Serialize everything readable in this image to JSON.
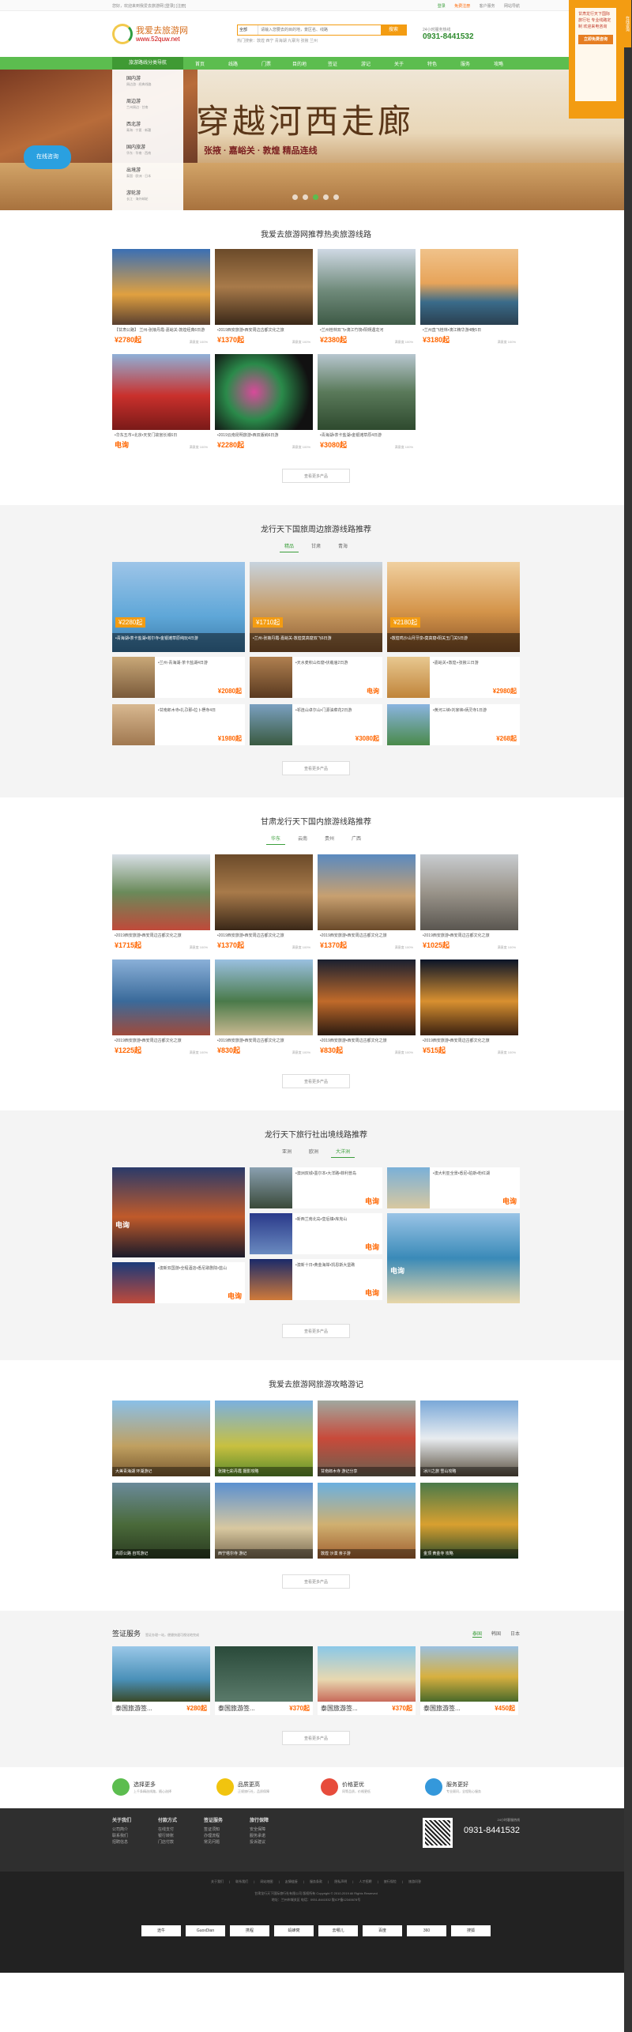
{
  "topbar": {
    "welcome": "您好，欢迎来到我爱去旅游网 [登录] [注册]",
    "links": [
      "登录",
      "免费注册",
      "客户服务",
      "网站导航"
    ]
  },
  "header": {
    "logo_cn": "我爱去旅游网",
    "logo_url": "www.52quw.net",
    "search_select": "全部",
    "search_placeholder": "请输入您要去的目的地，景区名、线路",
    "search_button": "搜索",
    "hot": "热门搜索：敦煌 西宁 青海湖 九寨沟 张掖 兰州",
    "hotline_label": "24小时服务热线",
    "hotline": "0931-8441532"
  },
  "nav": {
    "category": "旅游路线分类导航",
    "items": [
      "首页",
      "线路",
      "门票",
      "目的地",
      "签证",
      "游记",
      "关于",
      "特色",
      "服务",
      "攻略"
    ]
  },
  "banner": {
    "title": "穿越河西走廊",
    "sub": "张掖 · 嘉峪关 · 敦煌 精品连线"
  },
  "catmenu": [
    {
      "t": "国内游",
      "s": "周边游 · 经典线路"
    },
    {
      "t": "周边游",
      "s": "兰州周边 · 甘南"
    },
    {
      "t": "西北游",
      "s": "青海 · 宁夏 · 新疆"
    },
    {
      "t": "国内旅游",
      "s": "华东 · 华南 · 西南"
    },
    {
      "t": "出境游",
      "s": "泰国 · 欧洲 · 日本"
    },
    {
      "t": "游轮游",
      "s": "长江 · 海外邮轮"
    }
  ],
  "online": "在线咨询",
  "sec1": {
    "title": "我爱去旅游网推荐热卖旅游线路",
    "more": "查看更多产品",
    "items": [
      {
        "t": "【甘肃公路】 兰州-张掖丹霞-嘉峪关-敦煌经典6日游",
        "p": "¥2780起",
        "s": "满意度 100%"
      },
      {
        "t": "•2019西安旅游•西安周边古都文化之旅",
        "p": "¥1370起",
        "s": "满意度 100%"
      },
      {
        "t": "•兰州桂林双飞•漓江竹筏•阳朔遇龙河",
        "p": "¥2380起",
        "s": "满意度 100%"
      },
      {
        "t": "•兰州直飞桂林•漓江精华游4晚5日",
        "p": "¥3180起",
        "s": "满意度 100%"
      },
      {
        "t": "•华东五市+北京•天安门故宫长城6日",
        "p": "电询",
        "s": "满意度 100%"
      },
      {
        "t": "•2019云南昆明旅游•西双版纳6日游",
        "p": "¥2280起",
        "s": "满意度 100%"
      },
      {
        "t": "•青海湖•茶卡盐湖•金银滩草原4日游",
        "p": "¥3080起",
        "s": "满意度 100%"
      },
      {
        "t": "",
        "p": "",
        "s": ""
      }
    ]
  },
  "sec2": {
    "title": "龙行天下国旅周边旅游线路推荐",
    "tabs": [
      "精品",
      "甘肃",
      "青海"
    ],
    "more": "查看更多产品",
    "feat": [
      {
        "p": "¥2280起",
        "c": "•青海湖•茶卡盐湖•塔尔寺•金银滩草原纯玩4日游"
      },
      {
        "p": "¥1710起",
        "c": "•兰州-张掖丹霞-嘉峪关-敦煌莫高窟双飞6日游"
      },
      {
        "p": "¥2180起",
        "c": "•敦煌鸣沙山月牙泉•莫高窟•阳关玉门关5日游"
      }
    ],
    "mini": [
      {
        "t": "•兰州-青海湖-茶卡盐湖4日游",
        "p": "¥2080起"
      },
      {
        "t": "•天水麦积山石窟•伏羲庙2日游",
        "p": "电询"
      },
      {
        "t": "•嘉峪关+敦煌+张掖三日游",
        "p": "¥2980起"
      },
      {
        "t": "•甘南郎木寺•扎尕那•拉卜楞寺4日",
        "p": "¥1980起"
      },
      {
        "t": "•祁连山卓尔山•门源油菜花2日游",
        "p": "¥3080起"
      },
      {
        "t": "•黄河三峡•刘家峡•炳灵寺1日游",
        "p": "¥268起"
      }
    ]
  },
  "sec3": {
    "title": "甘肃龙行天下国内旅游线路推荐",
    "tabs": [
      "华东",
      "云南",
      "贵州",
      "广西"
    ],
    "more": "查看更多产品",
    "items": [
      {
        "t": "•2019西安旅游•西安周边古都文化之旅",
        "p": "¥1715起",
        "s": "满意度 100%"
      },
      {
        "t": "•2019西安旅游•西安周边古都文化之旅",
        "p": "¥1370起",
        "s": "满意度 100%"
      },
      {
        "t": "•2019西安旅游•西安周边古都文化之旅",
        "p": "¥1370起",
        "s": "满意度 100%"
      },
      {
        "t": "•2019西安旅游•西安周边古都文化之旅",
        "p": "¥1025起",
        "s": "满意度 100%"
      },
      {
        "t": "•2019西安旅游•西安周边古都文化之旅",
        "p": "¥1225起",
        "s": "满意度 100%"
      },
      {
        "t": "•2019西安旅游•西安周边古都文化之旅",
        "p": "¥830起",
        "s": "满意度 100%"
      },
      {
        "t": "•2019西安旅游•西安周边古都文化之旅",
        "p": "¥830起",
        "s": "满意度 100%"
      },
      {
        "t": "•2019西安旅游•西安周边古都文化之旅",
        "p": "¥515起",
        "s": "满意度 100%"
      }
    ]
  },
  "sec4": {
    "title": "龙行天下旅行社出境线路推荐",
    "tabs": [
      "亚洲",
      "欧洲",
      "大洋洲"
    ],
    "more": "查看更多产品",
    "big1": "电询",
    "big2": "电询",
    "rows": [
      {
        "t": "•澳新双国游•全程酒店•悉尼歌剧院•蓝山",
        "p": "电询"
      },
      {
        "t": "•澳洲双城•墨尔本•大洋路•菲利普岛",
        "p": "电询"
      },
      {
        "t": "•新西兰南北岛•皇后镇•库克山",
        "p": "电询"
      },
      {
        "t": "•澳新十日•黄金海岸•凯恩斯大堡礁",
        "p": "电询"
      },
      {
        "t": "•澳大利亚全景•悉尼•珀斯•粉红湖",
        "p": "电询"
      }
    ]
  },
  "sec5": {
    "title": "我爱去旅游网旅游攻略游记",
    "more": "查看更多产品",
    "items": [
      "大美青海湖 环湖游记",
      "张掖七彩丹霞 摄影攻略",
      "甘南郎木寺 游记分享",
      "冰川之旅 雪山攻略",
      "高原公路 自驾游记",
      "西宁塔尔寺 游记",
      "敦煌 沙漠 亲子游",
      "金顶 黄金寺 攻略"
    ]
  },
  "visa": {
    "title": "签证服务",
    "note": "签证办理一站，便捷快速可视化地完成",
    "tabs": [
      "泰国",
      "韩国",
      "日本"
    ],
    "more": "查看更多产品",
    "items": [
      {
        "n": "泰国旅游签...",
        "p": "¥280起"
      },
      {
        "n": "泰国旅游签...",
        "p": "¥370起"
      },
      {
        "n": "泰国旅游签...",
        "p": "¥370起"
      },
      {
        "n": "泰国旅游签...",
        "p": "¥450起"
      }
    ]
  },
  "svc": [
    {
      "t": "选择更多",
      "s": "上千条精选线路，随心选择"
    },
    {
      "t": "品质更高",
      "s": "正规旅行社，品质保障"
    },
    {
      "t": "价格更优",
      "s": "同等品质，价格更低"
    },
    {
      "t": "服务更好",
      "s": "专业顾问，全程贴心服务"
    }
  ],
  "footer": {
    "cols": [
      {
        "h": "关于我们",
        "l": [
          "公司简介",
          "联系我们",
          "招聘信息"
        ]
      },
      {
        "h": "付款方式",
        "l": [
          "在线支付",
          "银行转账",
          "门店付款"
        ]
      },
      {
        "h": "签证服务",
        "l": [
          "签证须知",
          "办理流程",
          "常见问题"
        ]
      },
      {
        "h": "旅行保障",
        "l": [
          "安全保障",
          "服务承诺",
          "投诉建议"
        ]
      }
    ],
    "hotline_label": "24小时客服热线",
    "hotline": "0931-8441532"
  },
  "bottom": {
    "links": "关于我们 | 联系我们 | 网站地图 | 友情链接 | 服务条款 | 隐私声明 | 人才招聘 | 旅行保险 | 旅游问答",
    "copy1": "甘肃龙行天下国际旅行社有限公司 版权所有 Copyright © 2010-2019 All Rights Reserved",
    "copy2": "地址：兰州市城关区 电话：0931-8441532 陇ICP备12345678号",
    "partners": [
      "途牛",
      "GuoxDian",
      "携程",
      "蚂蜂窝",
      "去哪儿",
      "百度",
      "360",
      "搜狐"
    ]
  },
  "sidead": {
    "text": "甘肃龙行天下国际旅行社 专业线路定制 欢迎来电咨询",
    "btn": "立即免费咨询"
  },
  "sidebar": "在线咨询"
}
